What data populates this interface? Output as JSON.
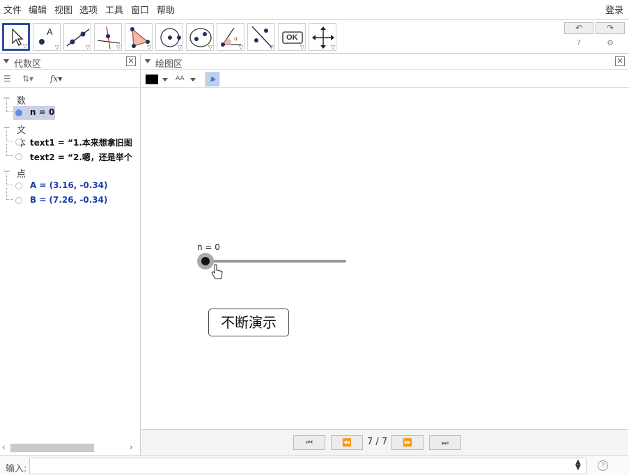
{
  "menubar": {
    "items": [
      "文件",
      "编辑",
      "视图",
      "选项",
      "工具",
      "窗口",
      "帮助"
    ],
    "login": "登录"
  },
  "toolbar": {
    "tools": [
      "move-tool",
      "point-tool",
      "line-tool",
      "perpendicular-tool",
      "polygon-tool",
      "circle-tool",
      "conic-tool",
      "angle-tool",
      "reflect-tool",
      "slider-tool",
      "move-view-tool"
    ],
    "ok_label": "OK",
    "undo_label": "↶",
    "redo_label": "↷",
    "help_glyph": "?",
    "settings_glyph": "⚙"
  },
  "algebra": {
    "title": "代数区",
    "fx_label": "fx",
    "categories": [
      {
        "label": "数值",
        "items": [
          {
            "text": "n = 0",
            "color": "black",
            "filled": true,
            "selected": true
          }
        ]
      },
      {
        "label": "文本",
        "items": [
          {
            "text": "text1 = “1.本来想拿旧图",
            "color": "black",
            "filled": false
          },
          {
            "text": "text2 = “2.嗯，还是举个",
            "color": "black",
            "filled": false
          }
        ]
      },
      {
        "label": "点",
        "items": [
          {
            "text": "A = (3.16, -0.34)",
            "color": "blue",
            "filled": false
          },
          {
            "text": "B = (7.26, -0.34)",
            "color": "blue",
            "filled": false
          }
        ]
      }
    ]
  },
  "graphics": {
    "title": "绘图区",
    "slider_label": "n = 0",
    "slider_value": 0,
    "demo_button": "不断演示",
    "nav": {
      "count": "7 / 7"
    }
  },
  "input": {
    "label": "输入:",
    "value": "",
    "help": "?"
  }
}
